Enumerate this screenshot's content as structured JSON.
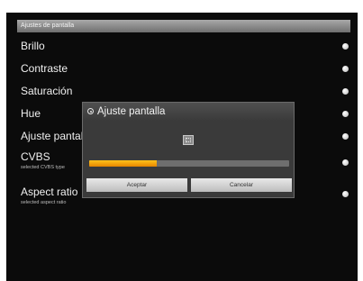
{
  "menu": {
    "header": "Ajustes de pantalla",
    "items": [
      {
        "label": "Brillo"
      },
      {
        "label": "Contraste"
      },
      {
        "label": "Saturación"
      },
      {
        "label": "Hue"
      },
      {
        "label": "Ajuste pantall"
      },
      {
        "label": "CVBS",
        "sub": "selected CVBS type"
      },
      {
        "label": "Aspect ratio",
        "sub": "selected aspect ratio"
      }
    ]
  },
  "dialog": {
    "title": "Ajuste pantalla",
    "progress": 0.34,
    "ok_label": "Aceptar",
    "cancel_label": "Cancelar"
  },
  "colors": {
    "progress_fill": "#f0a000",
    "background": "#0b0b0b"
  },
  "icons": [
    "bullet-icon",
    "dialog-title-icon",
    "loading-icon"
  ]
}
